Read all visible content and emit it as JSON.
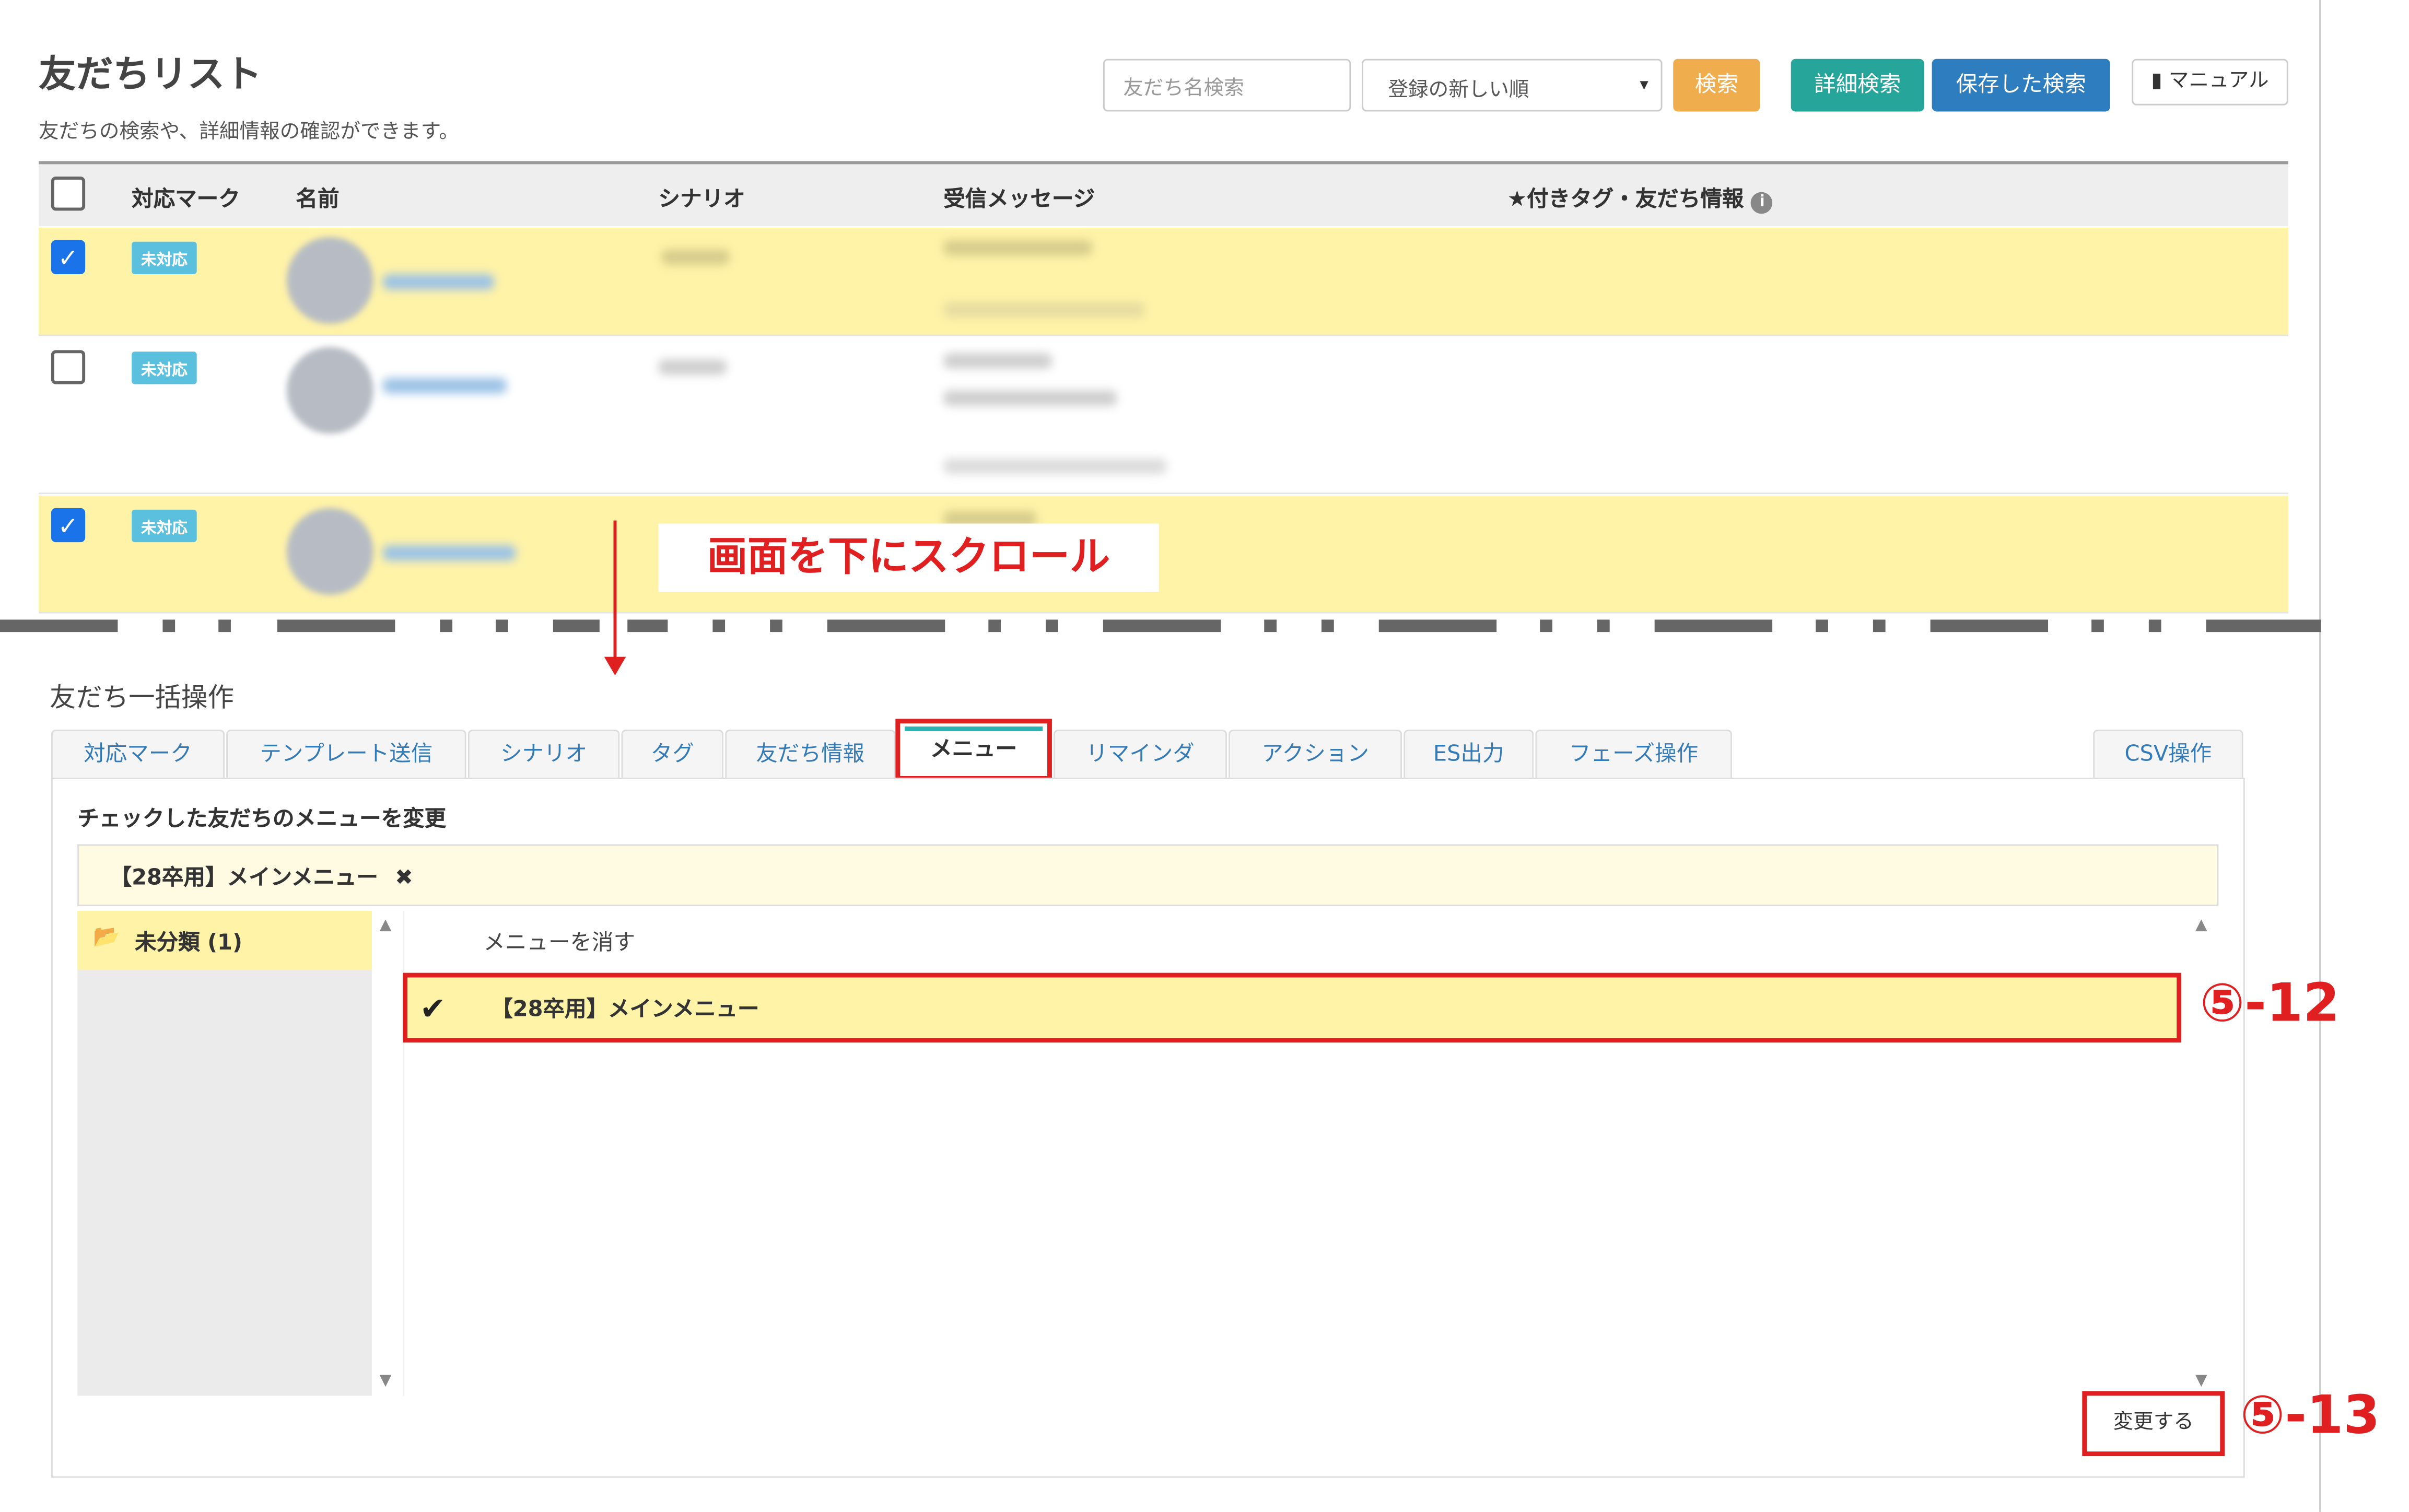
{
  "header": {
    "title": "友だちリスト",
    "subtitle": "友だちの検索や、詳細情報の確認ができます。",
    "search_placeholder": "友だち名検索",
    "sort_value": "登録の新しい順",
    "search_button": "検索",
    "advanced_search_button": "詳細検索",
    "saved_search_button": "保存した検索",
    "manual_button": "マニュアル"
  },
  "table": {
    "columns": [
      "対応マーク",
      "名前",
      "シナリオ",
      "受信メッセージ",
      "★付きタグ・友だち情報"
    ],
    "rows": [
      {
        "checked": true,
        "status": "未対応"
      },
      {
        "checked": false,
        "status": "未対応"
      },
      {
        "checked": true,
        "status": "未対応"
      }
    ]
  },
  "annotation": {
    "scroll_label": "画面を下にスクロール",
    "step_menu": "⑤-12",
    "step_change": "⑤-13"
  },
  "bulk": {
    "title": "友だち一括操作",
    "tabs": [
      "対応マーク",
      "テンプレート送信",
      "シナリオ",
      "タグ",
      "友だち情報",
      "メニュー",
      "リマインダ",
      "アクション",
      "ES出力",
      "フェーズ操作"
    ],
    "active_tab": "メニュー",
    "csv_tab": "CSV操作",
    "panel_label": "チェックした友だちのメニューを変更",
    "selected_menu": "【28卒用】メインメニュー",
    "folder": "未分類 (1)",
    "clear_option": "メニューを消す",
    "menu_item": "【28卒用】メインメニュー",
    "change_button": "変更する"
  },
  "colors": {
    "accent_red": "#e02020",
    "selected_row": "#fff3a8",
    "badge": "#5bc0de",
    "search_btn": "#f0ad4e",
    "adv_btn": "#26a69a",
    "saved_btn": "#2d7dbf"
  }
}
